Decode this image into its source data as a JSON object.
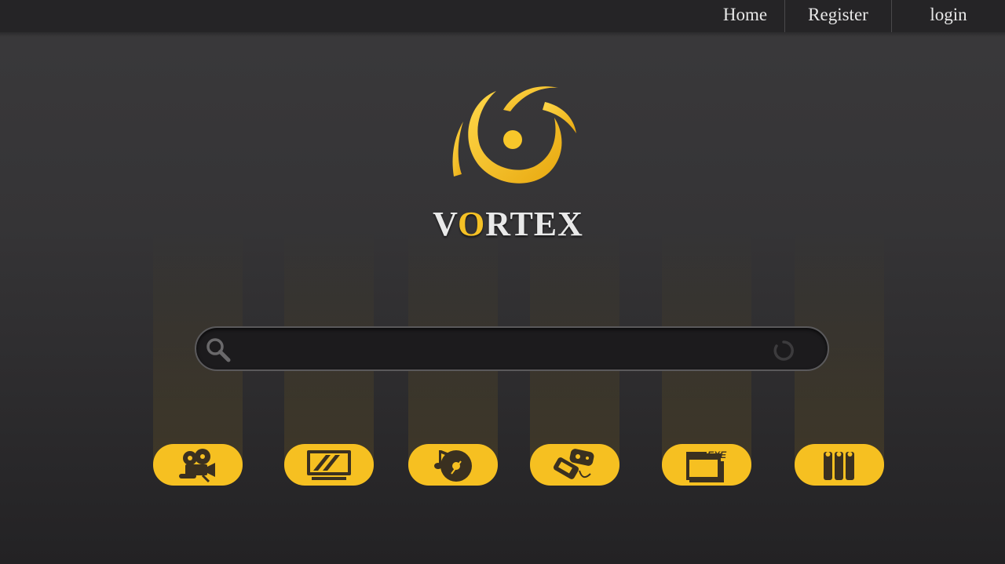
{
  "nav": {
    "home": "Home",
    "register": "Register",
    "login": "login"
  },
  "brand": {
    "before": "V",
    "o": "O",
    "after": "RTEX"
  },
  "search": {
    "placeholder": "",
    "value": ""
  },
  "categories": [
    {
      "icon": "film-camera-icon"
    },
    {
      "icon": "tv-icon"
    },
    {
      "icon": "music-disc-icon"
    },
    {
      "icon": "gamepad-icon"
    },
    {
      "icon": "exe-window-icon"
    },
    {
      "icon": "books-icon"
    }
  ],
  "colors": {
    "accent": "#f6c021",
    "background": "#353436",
    "topbar": "#252426"
  }
}
